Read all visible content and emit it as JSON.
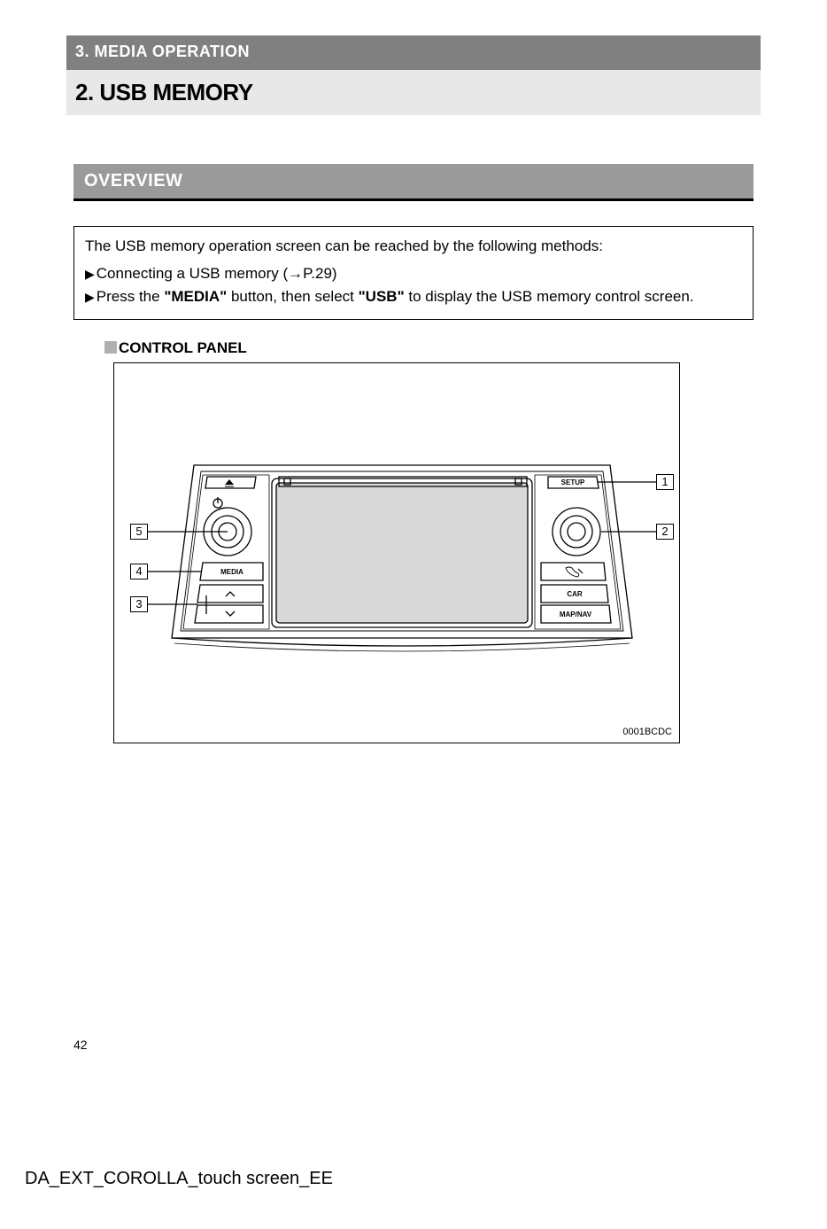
{
  "header": {
    "section": "3. MEDIA OPERATION",
    "title": "2. USB MEMORY"
  },
  "overview": {
    "heading": "OVERVIEW",
    "intro": "The USB memory operation screen can be reached by the following methods:",
    "line1": "Connecting a USB memory (→P.29)",
    "line2_pre": "Press the ",
    "line2_media": "\"MEDIA\"",
    "line2_mid": " button, then select ",
    "line2_usb": "\"USB\"",
    "line2_post": " to display the USB memory control screen."
  },
  "control_panel": {
    "heading": "CONTROL PANEL",
    "code": "0001BCDC",
    "labels": {
      "setup": "SETUP",
      "media": "MEDIA",
      "car": "CAR",
      "mapnav": "MAP/NAV"
    },
    "callouts": {
      "c1": "1",
      "c2": "2",
      "c3": "3",
      "c4": "4",
      "c5": "5"
    }
  },
  "page_number": "42",
  "footer": "DA_EXT_COROLLA_touch screen_EE"
}
